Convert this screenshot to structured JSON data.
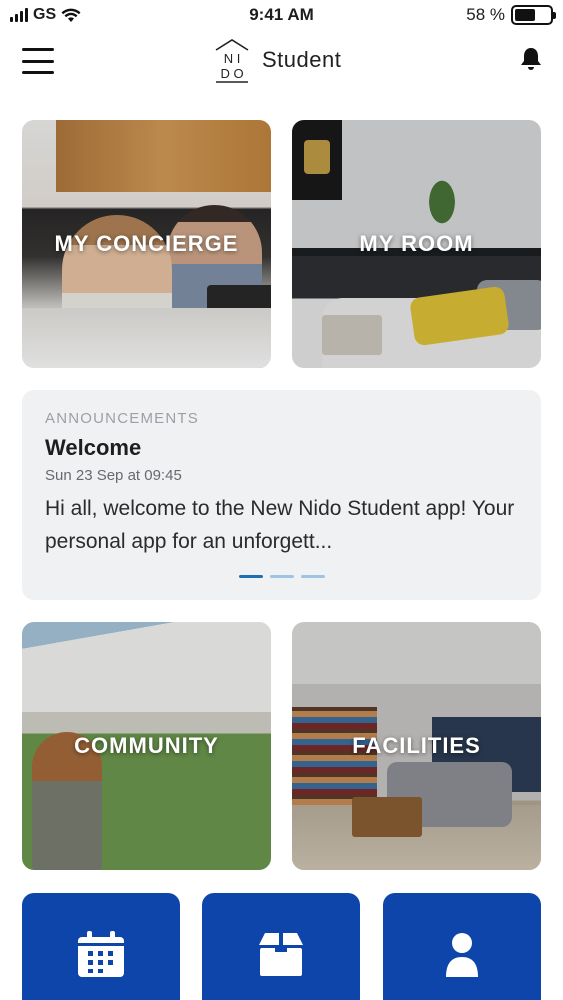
{
  "status_bar": {
    "carrier": "GS",
    "time": "9:41 AM",
    "battery": "58 %",
    "battery_level": 0.58
  },
  "header": {
    "logo_text_line1": "N I",
    "logo_text_line2": "D O",
    "brand_name": "Student",
    "menu_icon": "hamburger-icon",
    "notification_icon": "bell-icon"
  },
  "tiles": {
    "concierge": "MY CONCIERGE",
    "room": "MY ROOM",
    "community": "COMMUNITY",
    "facilities": "FACILITIES"
  },
  "announcements": {
    "heading": "ANNOUNCEMENTS",
    "title": "Welcome",
    "date": "Sun 23 Sep at 09:45",
    "body": "Hi all, welcome to the New Nido Student app! Your personal app for an unforgett...",
    "page_count": 3,
    "active_page": 1
  },
  "bottom_buttons": [
    {
      "icon": "calendar-icon"
    },
    {
      "icon": "package-icon"
    },
    {
      "icon": "profile-icon"
    }
  ],
  "colors": {
    "primary_button": "#0d45aa",
    "indicator_active": "#1f6fb5",
    "indicator_inactive": "#9ec3e4",
    "card_background": "#f0f1f3"
  }
}
